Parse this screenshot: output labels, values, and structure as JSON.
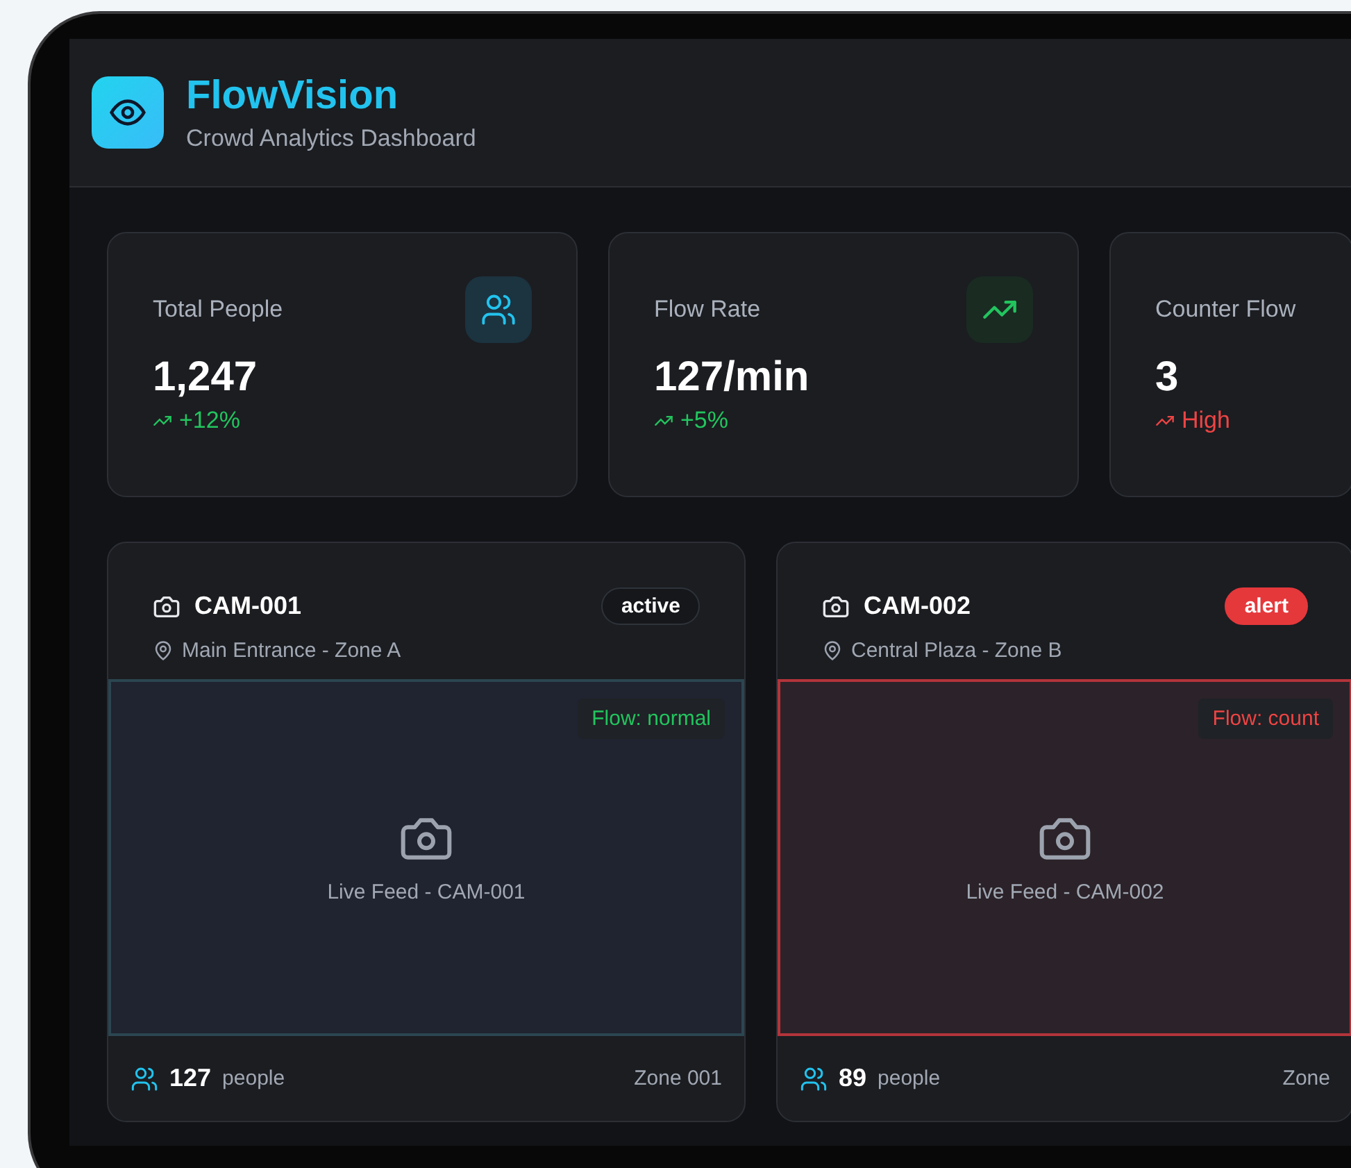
{
  "header": {
    "title": "FlowVision",
    "subtitle": "Crowd Analytics Dashboard"
  },
  "stats": [
    {
      "label": "Total People",
      "value": "1,247",
      "trend": "+12%",
      "color": "#22c55e",
      "kind": "people"
    },
    {
      "label": "Flow Rate",
      "value": "127/min",
      "trend": "+5%",
      "color": "#22c55e",
      "kind": "trend"
    },
    {
      "label": "Counter Flow",
      "value": "3",
      "trend": "High",
      "color": "#ef4444",
      "kind": "none"
    }
  ],
  "cameras": [
    {
      "name": "CAM-001",
      "location": "Main Entrance - Zone A",
      "status": "active",
      "alert": false,
      "flow": "Flow: normal",
      "feed": "Live Feed - CAM-001",
      "count": "127",
      "unit": "people",
      "zone": "Zone 001"
    },
    {
      "name": "CAM-002",
      "location": "Central Plaza - Zone B",
      "status": "alert",
      "alert": true,
      "flow": "Flow: count",
      "feed": "Live Feed - CAM-002",
      "count": "89",
      "unit": "people",
      "zone": "Zone"
    }
  ]
}
